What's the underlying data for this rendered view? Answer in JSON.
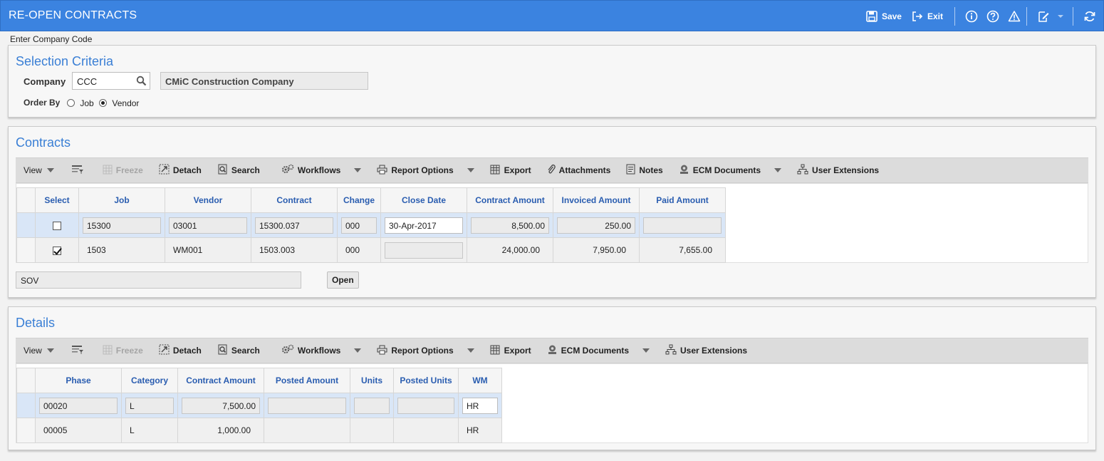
{
  "app": {
    "title": "RE-OPEN CONTRACTS",
    "actions": {
      "save_label": "Save",
      "exit_label": "Exit"
    },
    "hint": "Enter Company Code"
  },
  "selection": {
    "title": "Selection Criteria",
    "company_label": "Company",
    "company_value": "CCC",
    "company_name": "CMiC Construction Company",
    "order_by_label": "Order By",
    "order_options": [
      "Job",
      "Vendor"
    ],
    "order_selected": "Vendor"
  },
  "toolbar_labels": {
    "view": "View",
    "freeze": "Freeze",
    "detach": "Detach",
    "search": "Search",
    "workflows": "Workflows",
    "report_options": "Report Options",
    "export": "Export",
    "attachments": "Attachments",
    "notes": "Notes",
    "ecm_documents": "ECM Documents",
    "user_extensions": "User Extensions"
  },
  "contracts": {
    "title": "Contracts",
    "columns": [
      "Select",
      "Job",
      "Vendor",
      "Contract",
      "Change",
      "Close Date",
      "Contract Amount",
      "Invoiced Amount",
      "Paid Amount"
    ],
    "rows": [
      {
        "selected": false,
        "job": "15300",
        "vendor": "03001",
        "contract": "15300.037",
        "change": "000",
        "close_date": "30-Apr-2017",
        "contract_amount": "8,500.00",
        "invoiced_amount": "250.00",
        "paid_amount": ""
      },
      {
        "selected": true,
        "job": "1503",
        "vendor": "WM001",
        "contract": "1503.003",
        "change": "000",
        "close_date": "",
        "contract_amount": "24,000.00",
        "invoiced_amount": "7,950.00",
        "paid_amount": "7,655.00"
      }
    ],
    "sov_value": "SOV",
    "open_label": "Open"
  },
  "details": {
    "title": "Details",
    "columns": [
      "Phase",
      "Category",
      "Contract Amount",
      "Posted Amount",
      "Units",
      "Posted Units",
      "WM"
    ],
    "rows": [
      {
        "phase": "00020",
        "category": "L",
        "contract_amount": "7,500.00",
        "posted_amount": "",
        "units": "",
        "posted_units": "",
        "wm": "HR"
      },
      {
        "phase": "00005",
        "category": "L",
        "contract_amount": "1,000.00",
        "posted_amount": "",
        "units": "",
        "posted_units": "",
        "wm": "HR"
      }
    ]
  }
}
